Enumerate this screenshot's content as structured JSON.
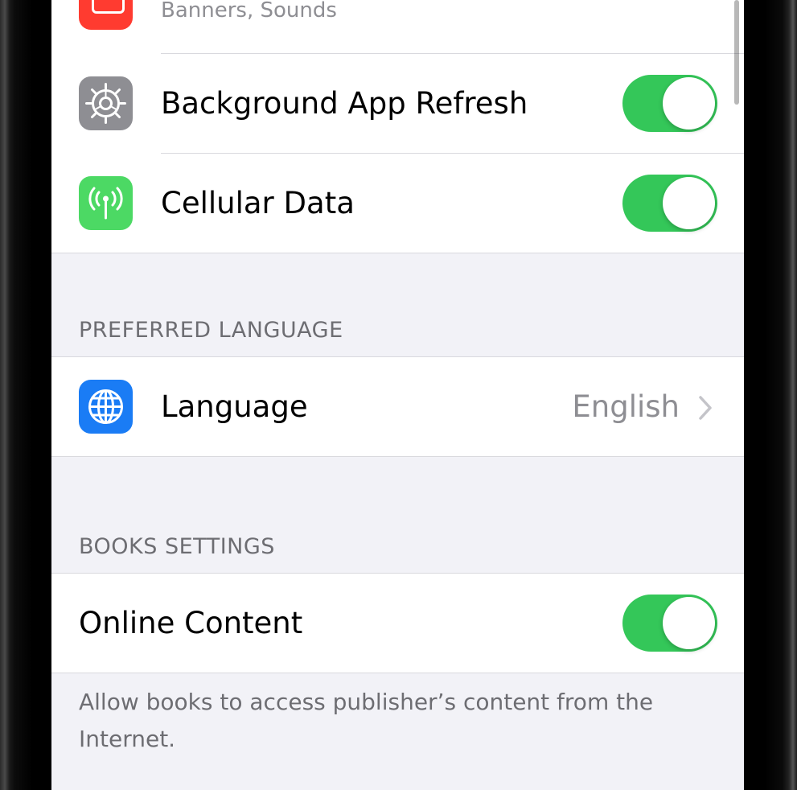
{
  "app_settings": {
    "notifications_subtitle": "Banners, Sounds",
    "background_app_refresh": {
      "label": "Background App Refresh",
      "on": true,
      "icon": "gear-icon"
    },
    "cellular_data": {
      "label": "Cellular Data",
      "on": true,
      "icon": "antenna-icon"
    }
  },
  "preferred_language": {
    "header": "PREFERRED LANGUAGE",
    "language_label": "Language",
    "language_value": "English",
    "icon": "globe-icon"
  },
  "books_settings": {
    "header": "BOOKS SETTINGS",
    "online_content_label": "Online Content",
    "online_content_on": true,
    "footer": "Allow books to access publisher’s content from the Internet."
  },
  "colors": {
    "toggle_on": "#34c759",
    "gear_icon_bg": "#8e8e93",
    "cellular_icon_bg": "#4cd964",
    "globe_icon_bg": "#1a7cf5",
    "notifications_icon_bg": "#ff3b30",
    "group_bg": "#f2f2f7"
  }
}
